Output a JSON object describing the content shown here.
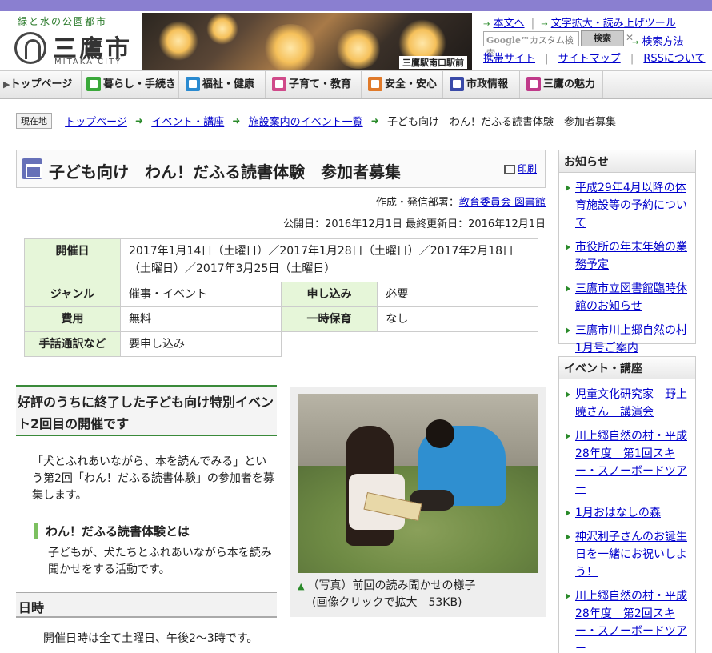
{
  "header": {
    "tagline": "緑と水の公園都市",
    "city_name": "三鷹市",
    "city_sub": "MITAKA CITY",
    "photo_caption": "三鷹駅南口駅前",
    "links": {
      "honbun": "本文へ",
      "moji": "文字拡大・読み上げツール",
      "search_placeholder": "カスタム検索",
      "google_label": "Google™",
      "search_button": "検索",
      "search_help": "検索方法",
      "mobile": "携帯サイト",
      "sitemap": "サイトマップ",
      "rss": "RSSについて"
    }
  },
  "nav": [
    {
      "label": "トップページ",
      "color": ""
    },
    {
      "label": "暮らし・手続き",
      "color": "#3aa83a"
    },
    {
      "label": "福祉・健康",
      "color": "#2a8ad0"
    },
    {
      "label": "子育て・教育",
      "color": "#d04a8a"
    },
    {
      "label": "安全・安心",
      "color": "#e07a2a"
    },
    {
      "label": "市政情報",
      "color": "#3a4aa8"
    },
    {
      "label": "三鷹の魅力",
      "color": "#c03a8a"
    }
  ],
  "breadcrumb": {
    "here_label": "現在地",
    "items": [
      "トップページ",
      "イベント・講座",
      "施設案内のイベント一覧"
    ],
    "current": "子ども向け　わん！だふる読書体験　参加者募集"
  },
  "page": {
    "title": "子ども向け　わん！だふる読書体験　参加者募集",
    "print": "印刷",
    "author_prefix": "作成・発信部署：",
    "author": "教育委員会 図書館",
    "dates": "公開日：2016年12月1日 最終更新日：2016年12月1日"
  },
  "info": {
    "date_label": "開催日",
    "date_value": "2017年1月14日（土曜日）／2017年1月28日（土曜日）／2017年2月18日（土曜日）／2017年3月25日（土曜日）",
    "genre_label": "ジャンル",
    "genre_value": "催事・イベント",
    "apply_label": "申し込み",
    "apply_value": "必要",
    "cost_label": "費用",
    "cost_value": "無料",
    "care_label": "一時保育",
    "care_value": "なし",
    "sign_label": "手話通訳など",
    "sign_value": "要申し込み"
  },
  "content": {
    "heading": "好評のうちに終了した子ども向け特別イベント2回目の開催です",
    "intro": "「犬とふれあいながら、本を読んでみる」という第2回「わん！だふる読書体験」の参加者を募集します。",
    "sub_heading": "わん！だふる読書体験とは",
    "sub_text": "子どもが、犬たちとふれあいながら本を読み聞かせをする活動です。",
    "nichiji_heading": "日時",
    "nichiji_text": "開催日時は全て土曜日、午後2〜3時です。",
    "figure_caption_1": "（写真）前回の読み聞かせの様子",
    "figure_caption_2": "(画像クリックで拡大　53KB)"
  },
  "sidebar": {
    "news_title": "お知らせ",
    "news": [
      "平成29年4月以降の体育施設等の予約について",
      "市役所の年末年始の業務予定",
      "三鷹市立図書館臨時休館のお知らせ",
      "三鷹市川上郷自然の村1月号ご案内"
    ],
    "events_title": "イベント・講座",
    "events": [
      "児童文化研究家　野上暁さん　講演会",
      "川上郷自然の村・平成28年度　第1回スキー・スノーボードツアー",
      "1月おはなしの森",
      "神沢利子さんのお誕生日を一緒にお祝いしよう！",
      "川上郷自然の村・平成28年度　第2回スキー・スノーボードツアー"
    ]
  }
}
